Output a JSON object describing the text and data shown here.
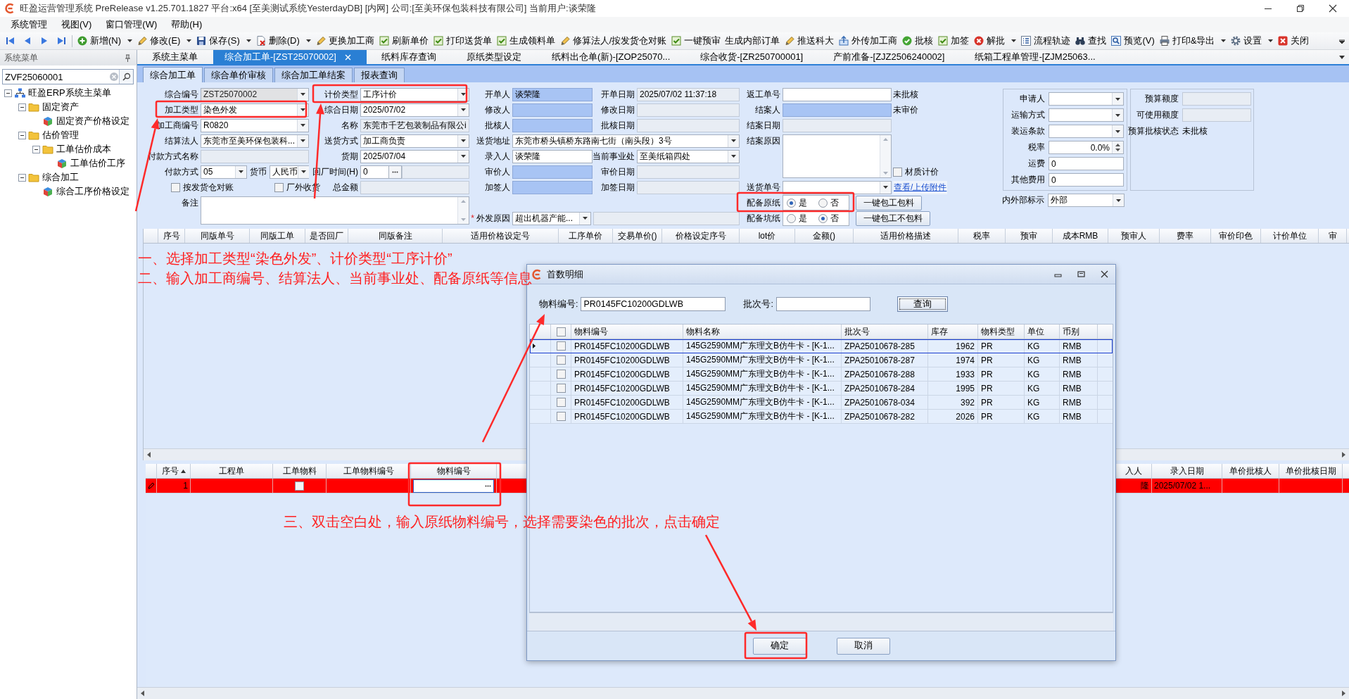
{
  "window": {
    "title": "旺盈运营管理系统 PreRelease v1.25.701.1827 平台:x64  [至美测试系统YesterdayDB] [内网] 公司:[至美环保包装科技有限公司] 当前用户:谈荣隆"
  },
  "menu": [
    {
      "label": "系统管理"
    },
    {
      "label": "视图(V)"
    },
    {
      "label": "窗口管理(W)"
    },
    {
      "label": "帮助(H)"
    }
  ],
  "toolbar": [
    {
      "label": "新增(N)",
      "kind": "menu"
    },
    {
      "label": "修改(E)",
      "kind": "menu"
    },
    {
      "label": "保存(S)",
      "kind": "menu"
    },
    {
      "label": "删除(D)",
      "kind": "menu"
    },
    {
      "label": "更换加工商",
      "kind": "button"
    },
    {
      "label": "刷新单价",
      "kind": "button"
    },
    {
      "label": "打印送货单",
      "kind": "button"
    },
    {
      "label": "生成领料单",
      "kind": "button"
    },
    {
      "label": "修算法人/按发货仓对账",
      "kind": "button"
    },
    {
      "label": "一键预审",
      "kind": "button"
    },
    {
      "label": "生成内部订单",
      "kind": "button"
    },
    {
      "label": "推送科大",
      "kind": "button"
    },
    {
      "label": "外传加工商",
      "kind": "button"
    },
    {
      "label": "批核",
      "kind": "button"
    },
    {
      "label": "加签",
      "kind": "button"
    },
    {
      "label": "解批",
      "kind": "menu"
    },
    {
      "label": "流程轨迹",
      "kind": "button"
    },
    {
      "label": "查找",
      "kind": "button"
    },
    {
      "label": "预览(V)",
      "kind": "button"
    },
    {
      "label": "打印&导出",
      "kind": "menu"
    },
    {
      "label": "设置",
      "kind": "menu"
    },
    {
      "label": "关闭",
      "kind": "button"
    }
  ],
  "sidebar": {
    "title": "系统菜单",
    "search": {
      "value": "ZVF25060001"
    },
    "tree": [
      {
        "label": "旺盈ERP系统主菜单",
        "expanded": true,
        "children": [
          {
            "label": "固定资产",
            "expanded": true,
            "children": [
              {
                "label": "固定资产价格设定"
              }
            ]
          },
          {
            "label": "估价管理",
            "expanded": true,
            "children": [
              {
                "label": "工单估价成本",
                "expanded": true,
                "children": [
                  {
                    "label": "工单估价工序"
                  }
                ]
              }
            ]
          },
          {
            "label": "综合加工",
            "expanded": true,
            "children": [
              {
                "label": "综合工序价格设定"
              }
            ]
          }
        ]
      }
    ]
  },
  "tabs": [
    {
      "label": "系统主菜单",
      "selected": false
    },
    {
      "label": "综合加工单-[ZST25070002]",
      "selected": true
    },
    {
      "label": "纸料库存查询",
      "selected": false
    },
    {
      "label": "原纸类型设定",
      "selected": false
    },
    {
      "label": "纸料出仓单(新)-[ZOP25070...",
      "selected": false
    },
    {
      "label": "综合收货-[ZR250700001]",
      "selected": false
    },
    {
      "label": "产前准备-[ZJZ2506240002]",
      "selected": false
    },
    {
      "label": "纸箱工程单管理-[ZJM25063...",
      "selected": false
    }
  ],
  "subtabs": [
    {
      "label": "综合加工单",
      "selected": true
    },
    {
      "label": "综合单价审核",
      "selected": false
    },
    {
      "label": "综合加工单结案",
      "selected": false
    },
    {
      "label": "报表查询",
      "selected": false
    }
  ],
  "form": {
    "fields": [
      {
        "label": "综合编号",
        "value": "ZST25070002",
        "kind": "locked"
      },
      {
        "label": "计价类型",
        "value": "工序计价",
        "kind": "combo"
      },
      {
        "label": "开单人",
        "value": "谈荣隆",
        "kind": "filled"
      },
      {
        "label": "开单日期",
        "value": "2025/07/02 11:37:18",
        "kind": "readonly"
      },
      {
        "label": "返工单号",
        "kind": "text"
      },
      {
        "value": "未批核",
        "kind": "status"
      },
      {
        "label": "加工类型",
        "value": "染色外发",
        "kind": "combo"
      },
      {
        "label": "综合日期",
        "value": "2025/07/02",
        "kind": "combo"
      },
      {
        "label": "修改人",
        "kind": "filled"
      },
      {
        "label": "修改日期",
        "kind": "readonly"
      },
      {
        "label": "结案人",
        "kind": "filled"
      },
      {
        "value": "未审价",
        "kind": "status"
      },
      {
        "label": "加工商编号",
        "value": "R0820",
        "kind": "combo"
      },
      {
        "label": "名称",
        "value": "东莞市千艺包装制品有限公i",
        "kind": "readonly"
      },
      {
        "label": "批核人",
        "kind": "filled"
      },
      {
        "label": "批核日期",
        "kind": "readonly"
      },
      {
        "label": "结案日期",
        "kind": "readonly"
      },
      {
        "label": "结算法人",
        "value": "东莞市至美环保包装科...",
        "kind": "combo"
      },
      {
        "label": "送货方式",
        "value": "加工商负责",
        "kind": "combo"
      },
      {
        "label": "送货地址",
        "value": "东莞市桥头镇桥东路南七街（南头段）3号",
        "kind": "combo"
      },
      {
        "label": "结案原因",
        "kind": "textarea"
      },
      {
        "label": "付款方式名称",
        "kind": "readonly"
      },
      {
        "label": "货期",
        "value": "2025/07/04",
        "kind": "combo"
      },
      {
        "label": "录入人",
        "value": "谈荣隆",
        "kind": "text"
      },
      {
        "label": "当前事业处",
        "value": "至美纸箱四处",
        "kind": "combo"
      },
      {
        "label": "付款方式",
        "value": "05",
        "kind": "combo"
      },
      {
        "label": "货币",
        "value": "人民币",
        "kind": "combo"
      },
      {
        "label": "回厂时间(H)",
        "value": "0",
        "kind": "picker"
      },
      {
        "label": "审价人",
        "kind": "filled"
      },
      {
        "label": "审价日期",
        "kind": "readonly"
      },
      {
        "label": "材质计价",
        "kind": "checkbox",
        "checked": false
      },
      {
        "label": "按发货仓对账",
        "kind": "checkbox",
        "checked": false
      },
      {
        "label": "厂外收货",
        "kind": "checkbox",
        "checked": false
      },
      {
        "label": "总金额",
        "kind": "readonly"
      },
      {
        "label": "加签人",
        "kind": "filled"
      },
      {
        "label": "加签日期",
        "kind": "readonly"
      },
      {
        "label": "送货单号",
        "kind": "combo"
      },
      {
        "label": "查看/上传附件",
        "kind": "link"
      },
      {
        "label": "备注",
        "kind": "textarea"
      },
      {
        "label": "配备原纸",
        "kind": "radio",
        "options": [
          {
            "label": "是",
            "selected": true
          },
          {
            "label": "否",
            "selected": false
          }
        ]
      },
      {
        "label": "一键包工包料",
        "kind": "button"
      },
      {
        "marker": "*",
        "label": "外发原因",
        "value": "超出机器产能...",
        "kind": "combo"
      },
      {
        "label": "配备坑纸",
        "kind": "radio",
        "options": [
          {
            "label": "是",
            "selected": false
          },
          {
            "label": "否",
            "selected": true
          }
        ]
      },
      {
        "label": "一键包工不包料",
        "kind": "button"
      }
    ],
    "side_left": [
      {
        "label": "申请人",
        "kind": "combo"
      },
      {
        "label": "运输方式",
        "kind": "combo"
      },
      {
        "label": "装运条款",
        "kind": "combo"
      },
      {
        "label": "税率",
        "value": "0.0%",
        "kind": "spin"
      },
      {
        "label": "运费",
        "value": "0",
        "kind": "text"
      },
      {
        "label": "其他费用",
        "value": "0",
        "kind": "text"
      }
    ],
    "side_right": [
      {
        "label": "预算额度",
        "kind": "readonly"
      },
      {
        "label": "可使用额度",
        "kind": "readonly"
      },
      {
        "label": "预算批核状态",
        "value": "未批核",
        "kind": "status"
      }
    ],
    "side_below": [
      {
        "label": "内外部标示",
        "value": "外部",
        "kind": "combo"
      }
    ]
  },
  "upper_grid": {
    "columns": [
      "序号",
      "同版单号",
      "同版工单",
      "是否回厂",
      "同版备注",
      "适用价格设定号",
      "工序单价",
      "交易单价()",
      "价格设定序号",
      "lot价",
      "金额()",
      "适用价格描述",
      "税率",
      "预审",
      "成本RMB",
      "预审人",
      "费率",
      "审价印色",
      "计价单位",
      "审"
    ]
  },
  "lower_grid": {
    "columns": [
      {
        "label": "序号",
        "sorted": true
      },
      {
        "label": "工程单",
        "sorted": false
      },
      {
        "label": "工单物料",
        "sorted": false
      },
      {
        "label": "工单物料编号",
        "sorted": false
      },
      {
        "label": "物料编号",
        "sorted": false
      },
      {
        "label": "入人",
        "sorted": false
      },
      {
        "label": "录入日期",
        "sorted": false
      },
      {
        "label": "单价批核人",
        "sorted": false
      },
      {
        "label": "单价批核日期",
        "sorted": false
      }
    ],
    "rows": [
      {
        "selected": true,
        "no": "1",
        "material_checked": false,
        "entry_user": "隆",
        "entry_date": "2025/07/02 1..."
      }
    ]
  },
  "dialog": {
    "title": "首数明细",
    "search": [
      {
        "label": "物料编号:",
        "value": "PR0145FC10200GDLWB"
      },
      {
        "label": "批次号:"
      }
    ],
    "query_button": "查询",
    "all_checked": false,
    "columns": [
      "物料编号",
      "物料名称",
      "批次号",
      "库存",
      "物料类型",
      "单位",
      "币别"
    ],
    "rows": [
      {
        "selected": true,
        "checked": false,
        "cells": [
          "PR0145FC10200GDLWB",
          "145G2590MM广东理文B仿牛卡 - [K-1...",
          "ZPA25010678-285",
          "1962",
          "PR",
          "KG",
          "RMB"
        ]
      },
      {
        "selected": false,
        "checked": false,
        "cells": [
          "PR0145FC10200GDLWB",
          "145G2590MM广东理文B仿牛卡 - [K-1...",
          "ZPA25010678-287",
          "1974",
          "PR",
          "KG",
          "RMB"
        ]
      },
      {
        "selected": false,
        "checked": false,
        "cells": [
          "PR0145FC10200GDLWB",
          "145G2590MM广东理文B仿牛卡 - [K-1...",
          "ZPA25010678-288",
          "1933",
          "PR",
          "KG",
          "RMB"
        ]
      },
      {
        "selected": false,
        "checked": false,
        "cells": [
          "PR0145FC10200GDLWB",
          "145G2590MM广东理文B仿牛卡 - [K-1...",
          "ZPA25010678-284",
          "1995",
          "PR",
          "KG",
          "RMB"
        ]
      },
      {
        "selected": false,
        "checked": false,
        "cells": [
          "PR0145FC10200GDLWB",
          "145G2590MM广东理文B仿牛卡 - [K-1...",
          "ZPA25010678-034",
          "392",
          "PR",
          "KG",
          "RMB"
        ]
      },
      {
        "selected": false,
        "checked": false,
        "cells": [
          "PR0145FC10200GDLWB",
          "145G2590MM广东理文B仿牛卡 - [K-1...",
          "ZPA25010678-282",
          "2026",
          "PR",
          "KG",
          "RMB"
        ]
      }
    ],
    "buttons": [
      "确定",
      "取消"
    ]
  },
  "annotations": [
    "一、选择加工类型“染色外发”、计价类型“工序计价”",
    "二、输入加工商编号、结算法人、当前事业处、配备原纸等信息",
    "三、双击空白处，输入原纸物料编号，选择需要染色的批次，点击确定"
  ]
}
